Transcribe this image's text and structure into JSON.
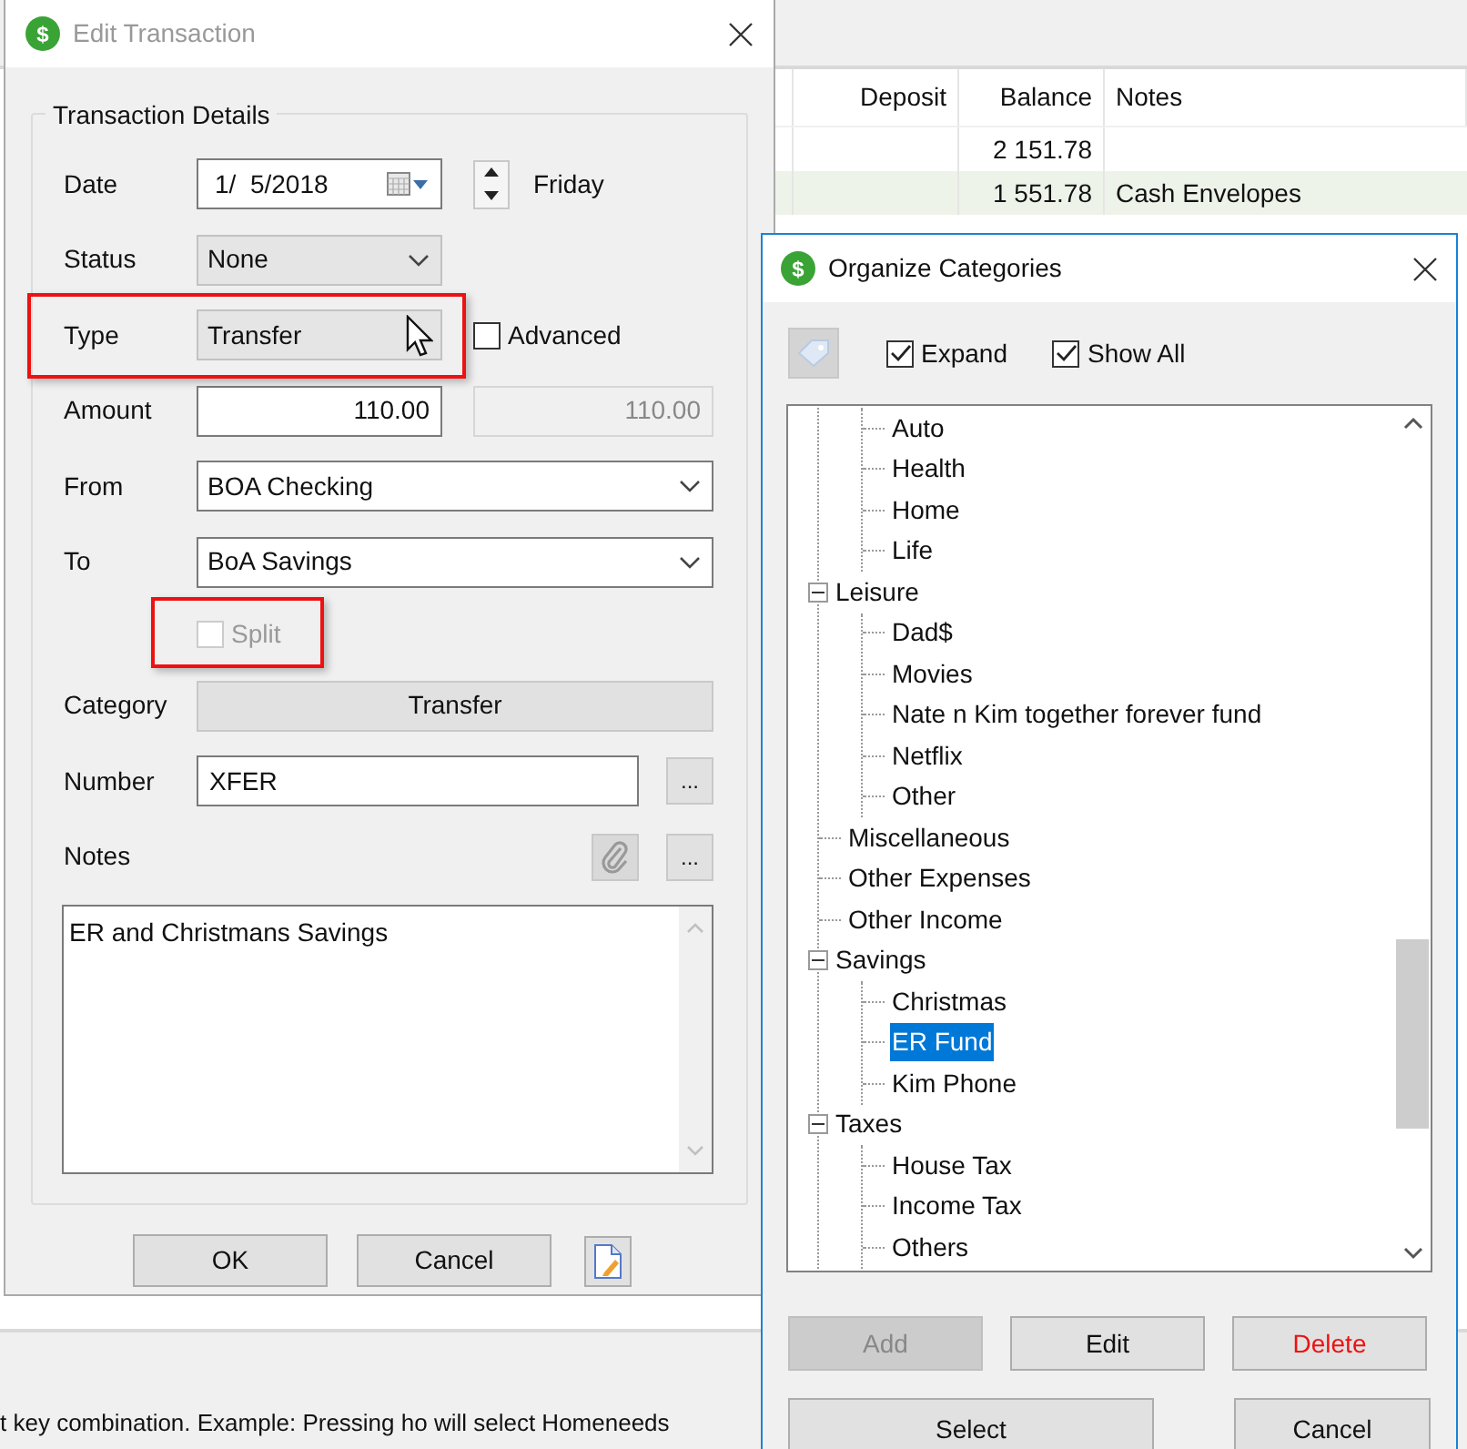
{
  "background": {
    "table": {
      "columns": [
        "Deposit",
        "Balance",
        "Notes"
      ],
      "rows": [
        {
          "balance": "2 151.78",
          "shaded": false
        },
        {
          "balance": "1 551.78",
          "notes": "Cash Envelopes",
          "shaded": true
        }
      ]
    },
    "status_text": "t key combination. Example: Pressing ho will select Homeneeds"
  },
  "edit_dialog": {
    "icon_glyph": "$",
    "title": "Edit Transaction",
    "group_title": "Transaction Details",
    "date": {
      "label": "Date",
      "value": "1/  5/2018",
      "day": "Friday"
    },
    "status": {
      "label": "Status",
      "value": "None"
    },
    "type": {
      "label": "Type",
      "value": "Transfer",
      "highlight": true,
      "advanced": {
        "label": "Advanced",
        "checked": false
      }
    },
    "amount": {
      "label": "Amount",
      "value": "110.00",
      "converted": "110.00"
    },
    "from": {
      "label": "From",
      "value": "BOA Checking"
    },
    "to": {
      "label": "To",
      "value": "BoA Savings"
    },
    "split": {
      "label": "Split",
      "checked": false,
      "disabled": true,
      "highlight": true
    },
    "category": {
      "label": "Category",
      "value": "Transfer"
    },
    "number": {
      "label": "Number",
      "value": "XFER",
      "more": "..."
    },
    "notes": {
      "label": "Notes",
      "more": "...",
      "value": "ER and Christmans Savings"
    },
    "buttons": [
      "OK",
      "Cancel"
    ]
  },
  "categories_dialog": {
    "icon_glyph": "$",
    "title": "Organize Categories",
    "options": [
      {
        "label": "Expand",
        "checked": true
      },
      {
        "label": "Show All",
        "checked": true
      }
    ],
    "tree": [
      {
        "children": [
          {
            "label": "Auto",
            "selected": false
          },
          {
            "label": "Health",
            "selected": false
          },
          {
            "label": "Home",
            "selected": false
          },
          {
            "label": "Life",
            "selected": false
          }
        ]
      },
      {
        "label": "Leisure",
        "selected": false,
        "expanded": true,
        "children": [
          {
            "label": "Dad$",
            "selected": false
          },
          {
            "label": "Movies",
            "selected": false
          },
          {
            "label": "Nate n Kim together forever fund",
            "selected": false
          },
          {
            "label": "Netflix",
            "selected": false
          },
          {
            "label": "Other",
            "selected": false
          }
        ]
      },
      {
        "label": "Miscellaneous",
        "selected": false
      },
      {
        "label": "Other Expenses",
        "selected": false
      },
      {
        "label": "Other Income",
        "selected": false
      },
      {
        "label": "Savings",
        "selected": false,
        "expanded": true,
        "children": [
          {
            "label": "Christmas",
            "selected": false
          },
          {
            "label": "ER Fund",
            "selected": true
          },
          {
            "label": "Kim Phone",
            "selected": false
          }
        ]
      },
      {
        "label": "Taxes",
        "selected": false,
        "expanded": true,
        "children": [
          {
            "label": "House Tax",
            "selected": false
          },
          {
            "label": "Income Tax",
            "selected": false
          },
          {
            "label": "Others",
            "selected": false
          }
        ]
      }
    ],
    "buttons": [
      {
        "label": "Add",
        "disabled": true,
        "kind": "normal"
      },
      {
        "label": "Edit",
        "disabled": false,
        "kind": "normal"
      },
      {
        "label": "Delete",
        "disabled": false,
        "kind": "danger"
      }
    ],
    "footer_buttons": [
      "Select",
      "Cancel"
    ]
  }
}
